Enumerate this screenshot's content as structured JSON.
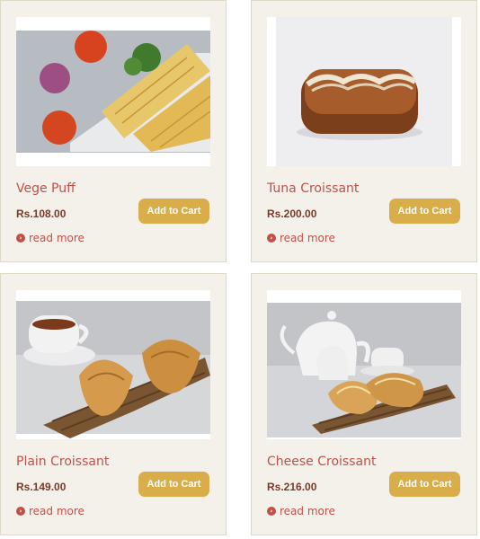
{
  "products": [
    {
      "name": "Vege Puff",
      "price": "Rs.108.00",
      "button": "Add to Cart",
      "more": "read more"
    },
    {
      "name": "Tuna Croissant",
      "price": "Rs.200.00",
      "button": "Add to Cart",
      "more": "read more"
    },
    {
      "name": "Plain Croissant",
      "price": "Rs.149.00",
      "button": "Add to Cart",
      "more": "read more"
    },
    {
      "name": "Cheese Croissant",
      "price": "Rs.216.00",
      "button": "Add to Cart",
      "more": "read more"
    }
  ],
  "colors": {
    "card_bg": "#f4f1ea",
    "accent_red": "#c0504a",
    "button_gold": "#d9ae4a",
    "price_brown": "#7a3a2a"
  }
}
